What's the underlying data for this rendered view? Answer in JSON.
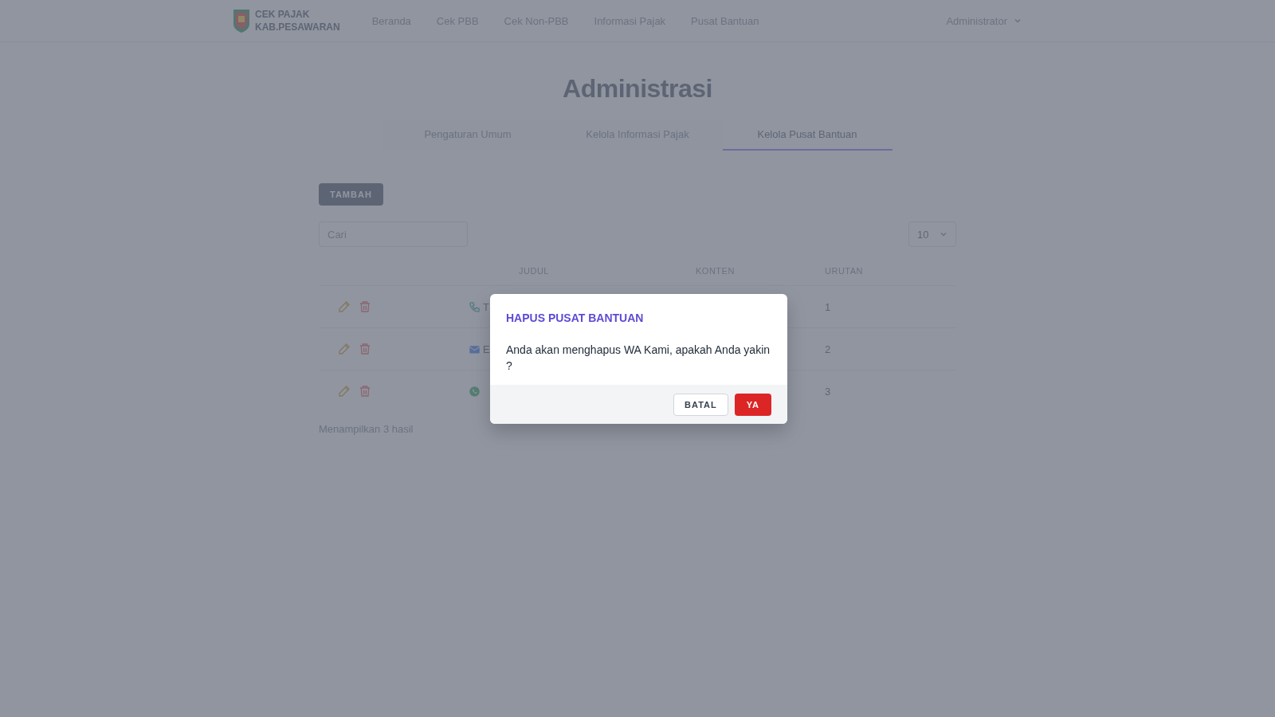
{
  "header": {
    "brand_lines": [
      "CEK PAJAK",
      "KAB.PESAWARAN"
    ],
    "nav": [
      {
        "label": "Beranda"
      },
      {
        "label": "Cek PBB"
      },
      {
        "label": "Cek Non-PBB"
      },
      {
        "label": "Informasi Pajak"
      },
      {
        "label": "Pusat Bantuan"
      }
    ],
    "user_menu": "Administrator"
  },
  "page_title": "Administrasi",
  "tabs": [
    {
      "label": "Pengaturan Umum",
      "selected": false
    },
    {
      "label": "Kelola Informasi Pajak",
      "selected": false
    },
    {
      "label": "Kelola Pusat Bantuan",
      "selected": true
    }
  ],
  "add_button": "TAMBAH",
  "search": {
    "placeholder": "Cari"
  },
  "page_size": "10",
  "table": {
    "columns": [
      "JUDUL",
      "KONTEN",
      "URUTAN"
    ],
    "rows": [
      {
        "kind": "phone",
        "judul": "T",
        "urutan": "1"
      },
      {
        "kind": "email",
        "judul": "E",
        "urutan": "2"
      },
      {
        "kind": "whatsapp",
        "urutan": "3"
      }
    ]
  },
  "result_count": "Menampilkan 3 hasil",
  "modal": {
    "title": "HAPUS PUSAT BANTUAN",
    "message": "Anda akan menghapus WA Kami, apakah Anda yakin ?",
    "cancel": "BATAL",
    "confirm": "YA"
  }
}
